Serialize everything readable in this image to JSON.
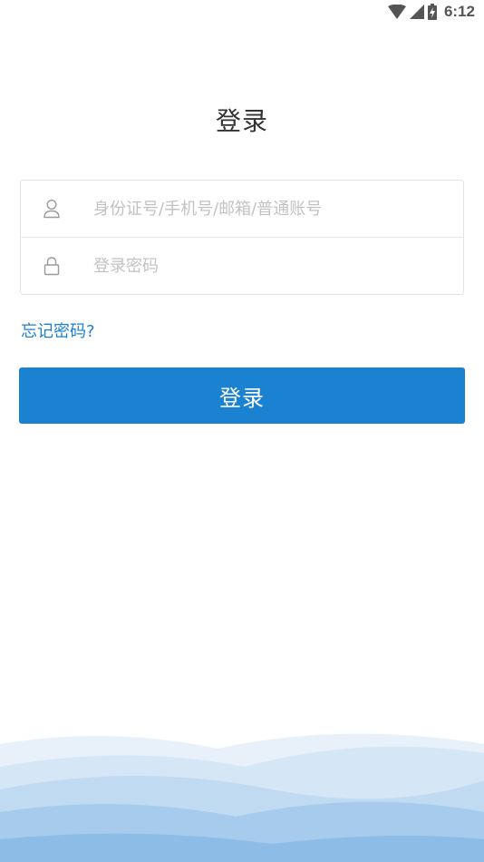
{
  "status_bar": {
    "time": "6:12",
    "icons": [
      "wifi-icon",
      "cell-signal-icon",
      "battery-charging-icon"
    ]
  },
  "login": {
    "title": "登录",
    "username_placeholder": "身份证号/手机号/邮箱/普通账号",
    "username_value": "",
    "password_placeholder": "登录密码",
    "password_value": "",
    "forgot_password": "忘记密码?",
    "submit_label": "登录"
  },
  "colors": {
    "primary": "#1b81d1",
    "link": "#1c7fd1",
    "title_text": "#333333",
    "placeholder": "#c2c2c2",
    "border": "#e3e3e3",
    "wave_light": "#dce9f6",
    "wave_dark": "#8dbce6"
  }
}
